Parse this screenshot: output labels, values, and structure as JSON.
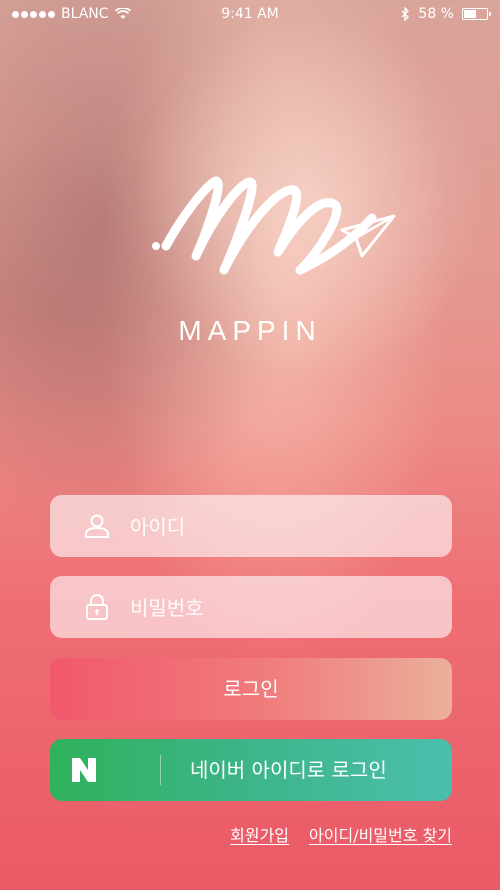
{
  "status_bar": {
    "carrier": "BLANC",
    "time": "9:41 AM",
    "battery": "58 %",
    "battery_level": 0.58,
    "signal_icon": "signal-dots-icon",
    "wifi_icon": "wifi-icon",
    "bluetooth_icon": "bluetooth-icon",
    "battery_icon": "battery-icon"
  },
  "brand": {
    "name": "MAPPIN",
    "logo_icon": "mappin-logo-icon"
  },
  "form": {
    "id_placeholder": "아이디",
    "password_placeholder": "비밀번호",
    "user_icon": "user-icon",
    "lock_icon": "lock-icon"
  },
  "buttons": {
    "login": "로그인",
    "naver_login": "네이버 아이디로 로그인",
    "naver_icon": "naver-n-icon"
  },
  "links": {
    "signup": "회원가입",
    "find_account": "아이디/비밀번호 찾기"
  },
  "colors": {
    "login_start": "#f1586d",
    "login_end": "#eab09a",
    "naver_start": "#2fb25b",
    "naver_end": "#4bbfad"
  }
}
